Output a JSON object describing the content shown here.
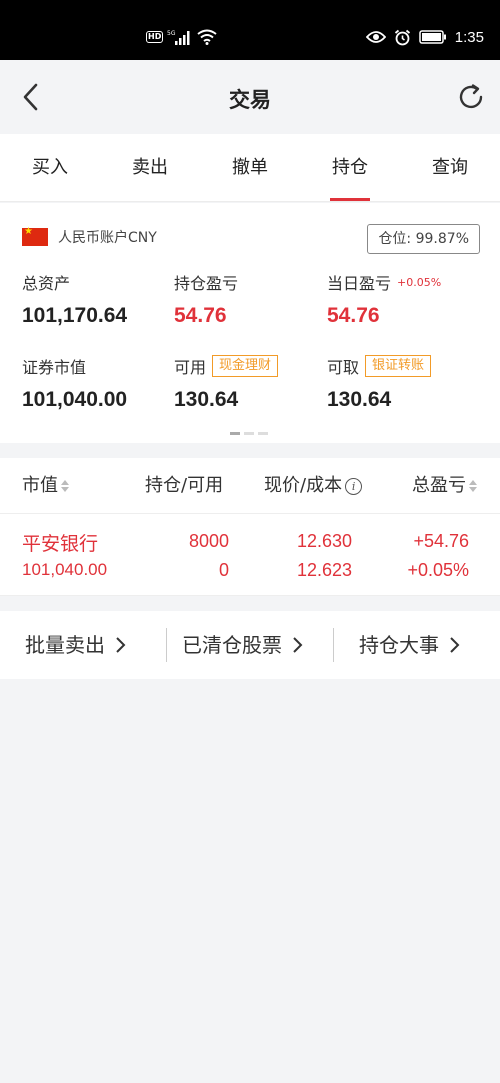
{
  "status_bar": {
    "hd_badge": "HD",
    "network": "5G",
    "time": "1:35",
    "icons": [
      "signal-icon",
      "wifi-icon",
      "eye-icon",
      "alarm-icon",
      "battery-icon"
    ]
  },
  "header": {
    "title": "交易",
    "back_icon": "chevron-left-icon",
    "refresh_icon": "refresh-icon"
  },
  "tabs": [
    {
      "label": "买入",
      "active": false
    },
    {
      "label": "卖出",
      "active": false
    },
    {
      "label": "撤单",
      "active": false
    },
    {
      "label": "持仓",
      "active": true
    },
    {
      "label": "查询",
      "active": false
    }
  ],
  "account": {
    "name": "人民币账户CNY",
    "flag_icon": "china-flag-icon",
    "position_label": "仓位:",
    "position_value": "99.87%",
    "total_assets_label": "总资产",
    "total_assets": "101,170.64",
    "holding_pnl_label": "持仓盈亏",
    "holding_pnl": "54.76",
    "daily_pnl_label": "当日盈亏",
    "daily_pnl_pct": "+0.05%",
    "daily_pnl": "54.76",
    "market_value_label": "证券市值",
    "market_value": "101,040.00",
    "available_label": "可用",
    "available_tag": "现金理财",
    "available": "130.64",
    "withdrawable_label": "可取",
    "withdrawable_tag": "银证转账",
    "withdrawable": "130.64",
    "pager": {
      "pages": 3,
      "current": 1
    }
  },
  "holdings": {
    "headers": {
      "market_value": "市值",
      "qty": "持仓/可用",
      "price": "现价/成本",
      "pnl": "总盈亏"
    },
    "rows": [
      {
        "name": "平安银行",
        "market_value": "101,040.00",
        "position": "8000",
        "available": "0",
        "price": "12.630",
        "cost": "12.623",
        "pnl": "+54.76",
        "pnl_pct": "+0.05%"
      }
    ]
  },
  "links": [
    {
      "label": "批量卖出"
    },
    {
      "label": "已清仓股票"
    },
    {
      "label": "持仓大事"
    }
  ],
  "colors": {
    "accent_red": "#e0323a",
    "tag_orange": "#f29b28",
    "background": "#f3f4f6"
  }
}
